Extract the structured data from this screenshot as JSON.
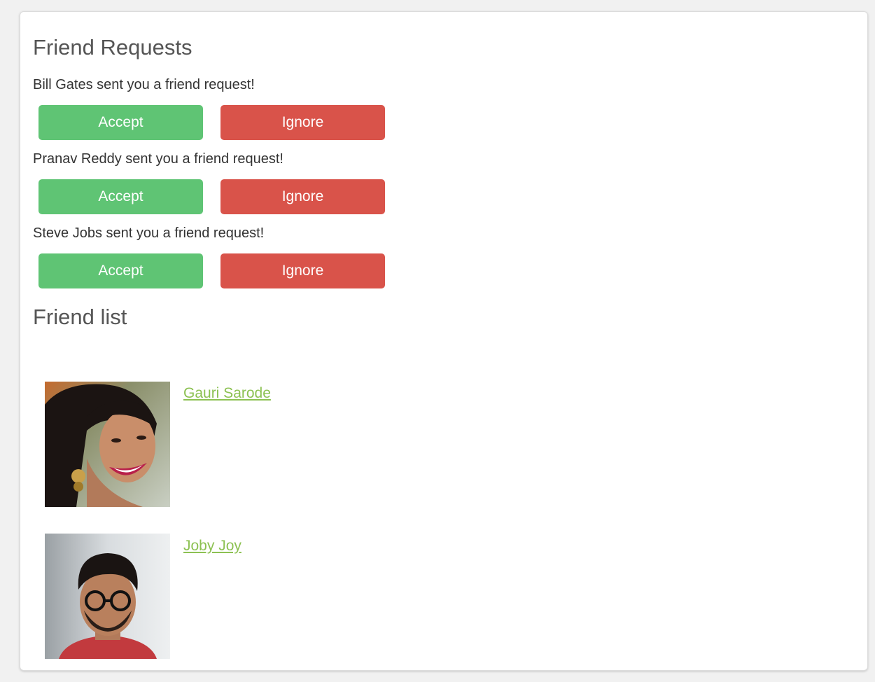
{
  "requests_section": {
    "title": "Friend Requests",
    "requests": [
      {
        "text": "Bill Gates sent you a friend request!",
        "accept_label": "Accept",
        "ignore_label": "Ignore"
      },
      {
        "text": "Pranav Reddy sent you a friend request!",
        "accept_label": "Accept",
        "ignore_label": "Ignore"
      },
      {
        "text": "Steve Jobs sent you a friend request!",
        "accept_label": "Accept",
        "ignore_label": "Ignore"
      }
    ]
  },
  "friends_section": {
    "title": "Friend list",
    "friends": [
      {
        "name": "Gauri Sarode"
      },
      {
        "name": "Joby Joy"
      }
    ]
  },
  "colors": {
    "accept": "#5fc474",
    "ignore": "#d9534a",
    "link": "#8cc152",
    "heading": "#555555"
  }
}
